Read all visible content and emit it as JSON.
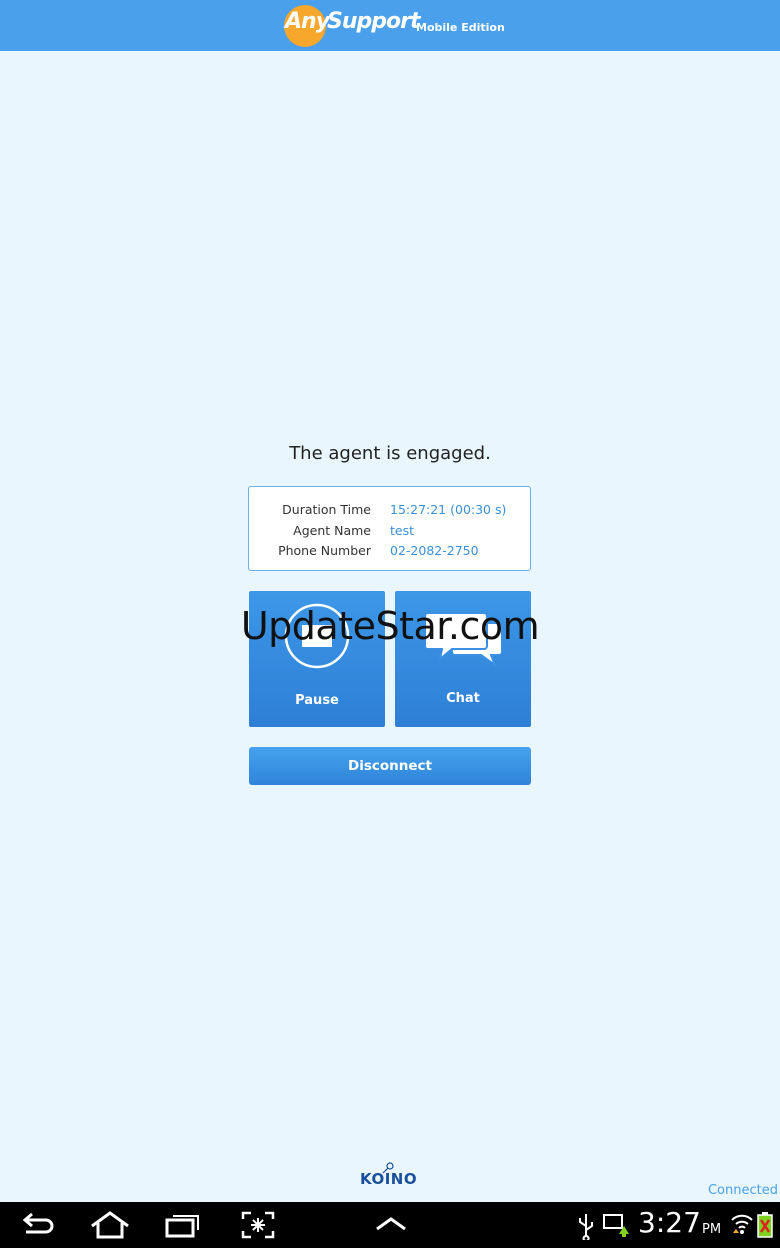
{
  "header": {
    "logo_any": "Any",
    "logo_support": "Support",
    "logo_edition": "Mobile Edition"
  },
  "status_message": "The agent is engaged.",
  "info": {
    "rows": [
      {
        "label": "Duration Time",
        "value": "15:27:21 (00:30 s)"
      },
      {
        "label": "Agent Name",
        "value": "test"
      },
      {
        "label": "Phone Number",
        "value": "02-2082-2750"
      }
    ]
  },
  "actions": {
    "pause_label": "Pause",
    "chat_label": "Chat",
    "disconnect_label": "Disconnect"
  },
  "watermark": "UpdateStar.com",
  "footer": {
    "brand": "KOINO",
    "connection_status": "Connected"
  },
  "system_bar": {
    "time": "3:27",
    "ampm": "PM",
    "icons": [
      "back-icon",
      "home-icon",
      "recent-apps-icon",
      "screenshot-icon",
      "up-chevron-icon",
      "usb-icon",
      "screen-mirror-icon",
      "wifi-icon",
      "battery-icon"
    ]
  },
  "colors": {
    "header": "#4aa0ea",
    "background": "#eaf6fd",
    "accent": "#3d97e7",
    "logo_orange": "#f6a72c",
    "link_text": "#3b8fd8"
  }
}
